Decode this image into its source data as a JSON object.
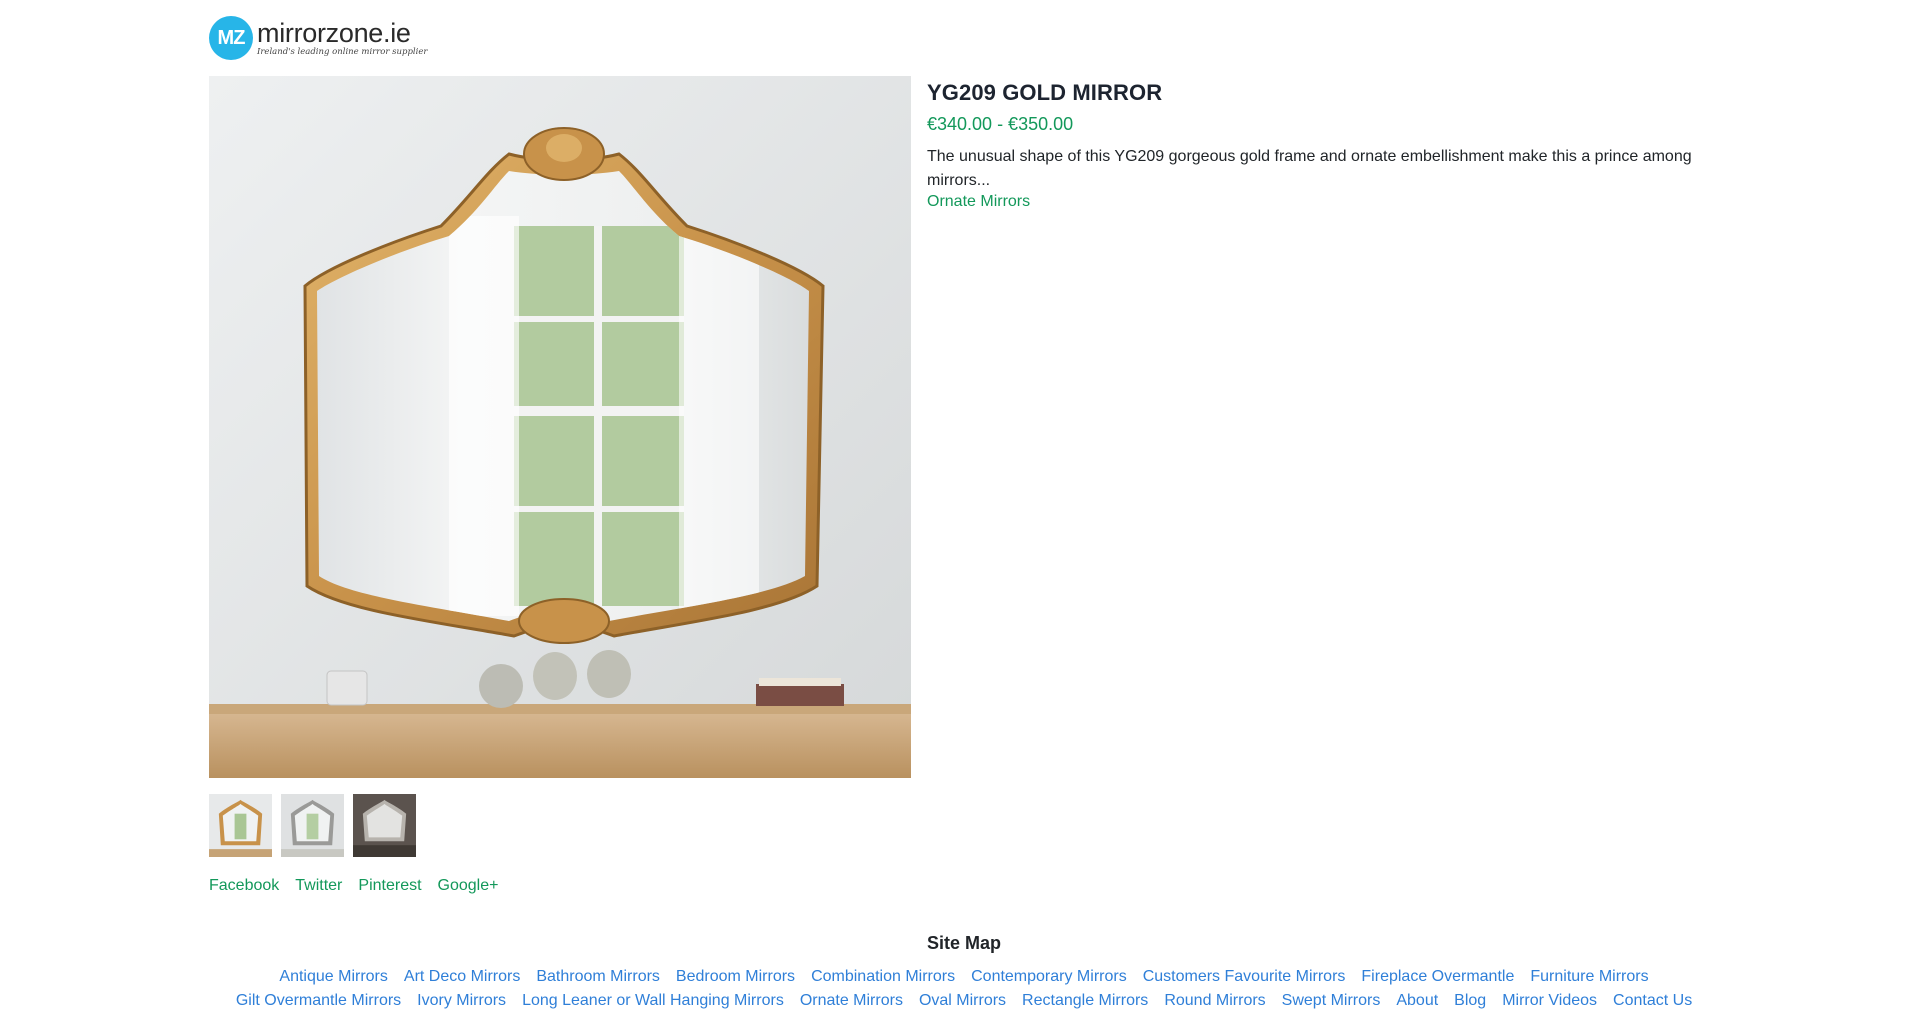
{
  "header": {
    "logo_initials": "MZ",
    "logo_name": "mirrorzone.ie",
    "logo_tagline": "Ireland's leading online mirror supplier"
  },
  "product": {
    "title": "YG209 GOLD MIRROR",
    "price": "€340.00 - €350.00",
    "description": "The unusual shape of this YG209 gorgeous gold frame and ornate embellishment make this a prince among mirrors...",
    "category_link": "Ornate Mirrors",
    "main_image_alt": "YG209 gold ornate mirror above a wooden shelf",
    "thumbnails": [
      "thumb-1",
      "thumb-2",
      "thumb-3"
    ]
  },
  "share": {
    "facebook": "Facebook",
    "twitter": "Twitter",
    "pinterest": "Pinterest",
    "googleplus": "Google+"
  },
  "sitemap": {
    "title": "Site Map",
    "links": [
      "Antique Mirrors",
      "Art Deco Mirrors",
      "Bathroom Mirrors",
      "Bedroom Mirrors",
      "Combination Mirrors",
      "Contemporary Mirrors",
      "Customers Favourite Mirrors",
      "Fireplace Overmantle",
      "Furniture Mirrors",
      "Gilt Overmantle Mirrors",
      "Ivory Mirrors",
      "Long Leaner or Wall Hanging Mirrors",
      "Ornate Mirrors",
      "Oval Mirrors",
      "Rectangle Mirrors",
      "Round Mirrors",
      "Swept Mirrors",
      "About",
      "Blog",
      "Mirror Videos",
      "Contact Us"
    ]
  },
  "colors": {
    "accent_green": "#13985a",
    "link_blue": "#2f7fd8",
    "logo_blue": "#27b5e8"
  }
}
